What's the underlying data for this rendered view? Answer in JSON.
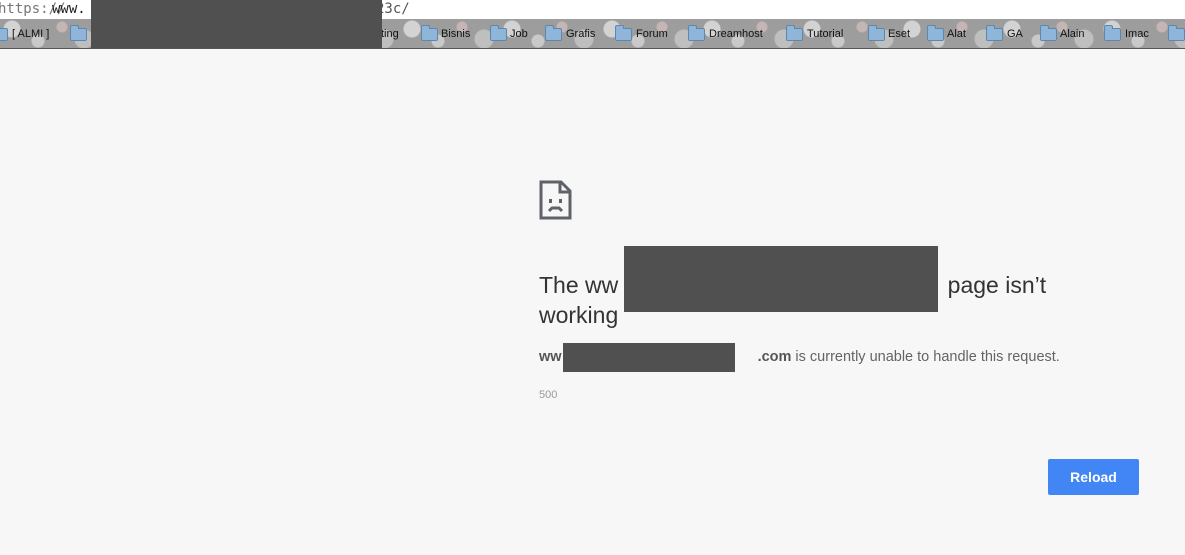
{
  "url_bar": {
    "scheme": "https://",
    "host_start": "www.",
    "path_end": "23c/"
  },
  "bookmarks": [
    {
      "label": "[ ALMI ]",
      "icon": "folder-icon"
    },
    {
      "label": "",
      "icon": "folder-icon"
    },
    {
      "label": "ting",
      "icon": ""
    },
    {
      "label": "Bisnis",
      "icon": "folder-icon"
    },
    {
      "label": "Job",
      "icon": "folder-icon"
    },
    {
      "label": "Grafis",
      "icon": "folder-icon"
    },
    {
      "label": "Forum",
      "icon": "folder-icon"
    },
    {
      "label": "Dreamhost",
      "icon": "folder-icon"
    },
    {
      "label": "Tutorial",
      "icon": "folder-icon"
    },
    {
      "label": "Eset",
      "icon": "folder-icon"
    },
    {
      "label": "Alat",
      "icon": "folder-icon"
    },
    {
      "label": "GA",
      "icon": "folder-icon"
    },
    {
      "label": "Alain",
      "icon": "folder-icon"
    },
    {
      "label": "Imac",
      "icon": "folder-icon"
    }
  ],
  "error": {
    "icon": "sad-document-icon",
    "heading_prefix": "The ",
    "heading_host": "ww",
    "heading_suffix": " page isn’t working",
    "desc_host_start": "ww",
    "desc_host_end": ".com",
    "desc_text": " is currently unable to handle this request.",
    "code": "500"
  },
  "buttons": {
    "reload_label": "Reload"
  },
  "colors": {
    "page_background": "#f7f7f7",
    "button_blue": "#4285f4",
    "redaction": "#505050"
  }
}
